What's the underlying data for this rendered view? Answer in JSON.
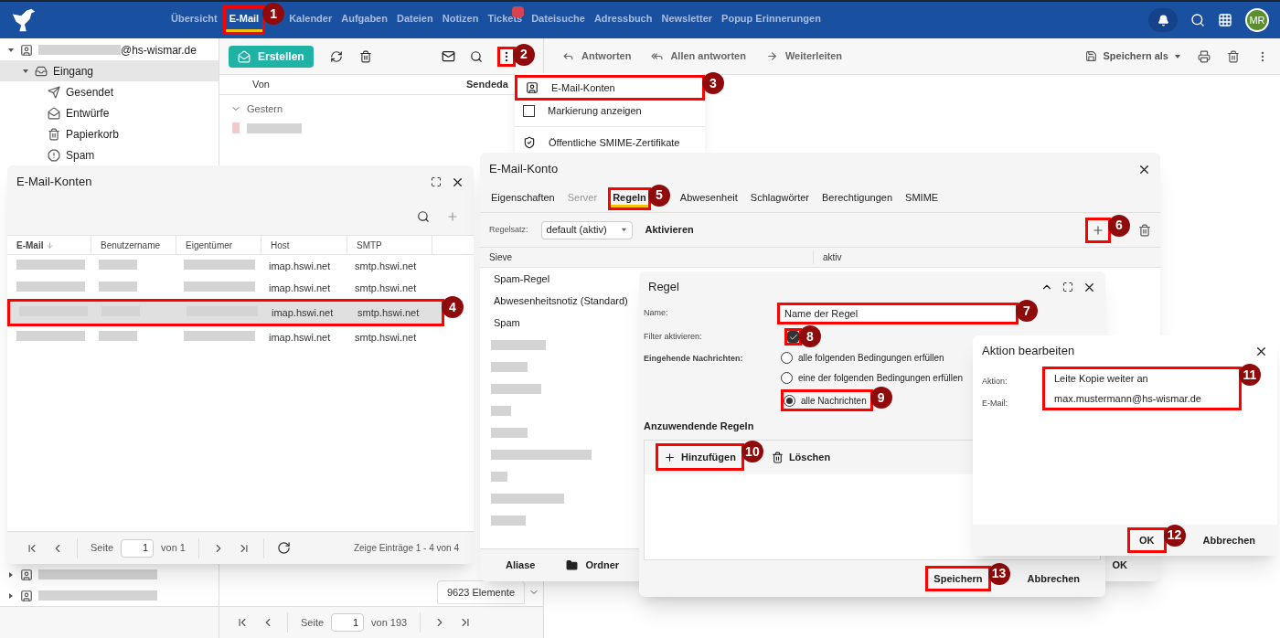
{
  "top_bar": {
    "nav": [
      {
        "label": "Übersicht",
        "selected": false,
        "has_badge": false
      },
      {
        "label": "E-Mail",
        "selected": true,
        "has_badge": false,
        "callout": "1"
      },
      {
        "label": "Kalender",
        "selected": false,
        "has_badge": false
      },
      {
        "label": "Aufgaben",
        "selected": false,
        "has_badge": false
      },
      {
        "label": "Dateien",
        "selected": false,
        "has_badge": false
      },
      {
        "label": "Notizen",
        "selected": false,
        "has_badge": false
      },
      {
        "label": "Tickets",
        "selected": false,
        "has_badge": true
      },
      {
        "label": "Dateisuche",
        "selected": false,
        "has_badge": false
      },
      {
        "label": "Adressbuch",
        "selected": false,
        "has_badge": false
      },
      {
        "label": "Newsletter",
        "selected": false,
        "has_badge": false
      },
      {
        "label": "Popup Erinnerungen",
        "selected": false,
        "has_badge": false
      }
    ],
    "avatar": "MR"
  },
  "sidebar": {
    "tree": [
      {
        "kind": "account",
        "label": "@hs-wismar.de",
        "expanded": true,
        "selected": false,
        "children": [
          {
            "kind": "inbox",
            "label": "Eingang",
            "expanded": true,
            "selected": true,
            "children": [
              {
                "kind": "sent",
                "label": "Gesendet",
                "selected": false
              },
              {
                "kind": "drafts",
                "label": "Entwürfe",
                "selected": false
              },
              {
                "kind": "trash",
                "label": "Papierkorb",
                "selected": false
              },
              {
                "kind": "spam",
                "label": "Spam",
                "selected": false
              }
            ]
          }
        ]
      },
      {
        "kind": "account",
        "expanded": false,
        "selected": false
      },
      {
        "kind": "account",
        "expanded": false,
        "selected": false
      }
    ]
  },
  "list_toolbar": {
    "create": "Erstellen",
    "more_callout": "2"
  },
  "message_list": {
    "columns": [
      "Von",
      "Sendeda"
    ],
    "group": "Gestern",
    "count": "9623 Elemente",
    "pager": {
      "page_label": "Seite",
      "page": "1",
      "of": "von 193"
    }
  },
  "reader_toolbar": {
    "actions": [
      {
        "kind": "reply",
        "label": "Antworten"
      },
      {
        "kind": "reply_all",
        "label": "Allen antworten"
      },
      {
        "kind": "forward",
        "label": "Weiterleiten"
      }
    ],
    "save": "Speichern als"
  },
  "menu": {
    "items": [
      {
        "kind": "contact",
        "label": "E-Mail-Konten",
        "callout": "3"
      },
      {
        "kind": "checkbox",
        "label": "Markierung anzeigen",
        "checked": false
      },
      {
        "kind": "shield",
        "label": "Öffentliche SMIME-Zertifikate",
        "divider_before": true
      }
    ]
  },
  "accounts_dialog": {
    "title": "E-Mail-Konten",
    "columns": [
      {
        "label": "E-Mail",
        "sorted": true
      },
      {
        "label": "Benutzername",
        "sorted": false
      },
      {
        "label": "Eigentümer",
        "sorted": false
      },
      {
        "label": "Host",
        "sorted": false
      },
      {
        "label": "SMTP",
        "sorted": false
      }
    ],
    "rows": [
      {
        "host": "imap.hswi.net",
        "smtp": "smtp.hswi.net",
        "selected": false
      },
      {
        "host": "imap.hswi.net",
        "smtp": "smtp.hswi.net",
        "selected": false
      },
      {
        "host": "imap.hswi.net",
        "smtp": "smtp.hswi.net",
        "selected": true,
        "callout": "4"
      },
      {
        "host": "imap.hswi.net",
        "smtp": "smtp.hswi.net",
        "selected": false
      }
    ],
    "pager": {
      "page_label": "Seite",
      "page": "1",
      "of": "von 1",
      "summary": "Zeige Einträge 1 - 4 von 4"
    }
  },
  "account_dialog": {
    "title": "E-Mail-Konto",
    "tabs": [
      {
        "label": "Eigenschaften",
        "selected": false,
        "disabled": false
      },
      {
        "label": "Server",
        "selected": false,
        "disabled": true
      },
      {
        "label": "Regeln",
        "selected": true,
        "disabled": false,
        "callout": "5"
      },
      {
        "label": "Abwesenheit",
        "selected": false,
        "disabled": false
      },
      {
        "label": "Schlagwörter",
        "selected": false,
        "disabled": false
      },
      {
        "label": "Berechtigungen",
        "selected": false,
        "disabled": false
      },
      {
        "label": "SMIME",
        "selected": false,
        "disabled": false
      }
    ],
    "ruleset_label": "Regelsatz:",
    "ruleset": "default (aktiv)",
    "activate": "Aktivieren",
    "add_callout": "6",
    "columns": [
      "Sieve",
      "aktiv"
    ],
    "rows": [
      "Spam-Regel",
      "Abwesenheitsnotiz (Standard)",
      "Spam"
    ],
    "footer": {
      "aliases": "Aliase",
      "folders": "Ordner",
      "ok": "OK"
    }
  },
  "rule_dialog": {
    "title": "Regel",
    "name_label": "Name:",
    "name": "Name der Regel",
    "name_callout": "7",
    "filter_label": "Filter aktivieren:",
    "filter_on": true,
    "filter_callout": "8",
    "incoming_label": "Eingehende Nachrichten:",
    "options": [
      {
        "label": "alle folgenden Bedingungen erfüllen",
        "selected": false
      },
      {
        "label": "eine der folgenden Bedingungen erfüllen",
        "selected": false
      },
      {
        "label": "alle Nachrichten",
        "selected": true,
        "callout": "9"
      }
    ],
    "section": "Anzuwendende Regeln",
    "add": "Hinzufügen",
    "add_callout": "10",
    "delete": "Löschen",
    "save": "Speichern",
    "save_callout": "13",
    "cancel": "Abbrechen"
  },
  "action_dialog": {
    "title": "Aktion bearbeiten",
    "fields_callout": "11",
    "fields": [
      {
        "label": "Aktion:",
        "value": "Leite Kopie weiter an"
      },
      {
        "label": "E-Mail:",
        "value": "max.mustermann@hs-wismar.de"
      }
    ],
    "ok": "OK",
    "ok_callout": "12",
    "cancel": "Abbrechen"
  }
}
